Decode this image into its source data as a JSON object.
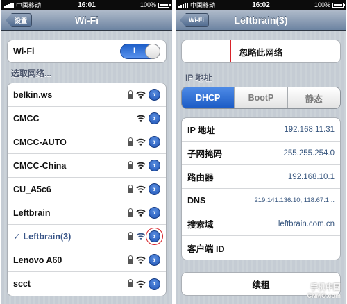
{
  "left": {
    "status": {
      "carrier": "中国移动",
      "time": "16:01",
      "battery": "100%"
    },
    "nav": {
      "back_label": "设置",
      "title": "Wi-Fi"
    },
    "wifi_toggle": {
      "label": "Wi-Fi",
      "state_label": "I"
    },
    "section_label": "选取网络...",
    "networks": [
      {
        "name": "belkin.ws",
        "locked": true
      },
      {
        "name": "CMCC",
        "locked": false
      },
      {
        "name": "CMCC-AUTO",
        "locked": true
      },
      {
        "name": "CMCC-China",
        "locked": true
      },
      {
        "name": "CU_A5c6",
        "locked": true
      },
      {
        "name": "Leftbrain",
        "locked": true
      },
      {
        "name": "Leftbrain(3)",
        "locked": true,
        "selected": true,
        "check": "✓"
      },
      {
        "name": "Lenovo A60",
        "locked": true
      },
      {
        "name": "scct",
        "locked": true
      }
    ]
  },
  "right": {
    "status": {
      "carrier": "中国移动",
      "time": "16:02",
      "battery": "100%"
    },
    "nav": {
      "back_label": "Wi-Fi",
      "title": "Leftbrain(3)"
    },
    "forget_label": "忽略此网络",
    "ip_section_label": "IP 地址",
    "segments": [
      "DHCP",
      "BootP",
      "静态"
    ],
    "fields": [
      {
        "label": "IP 地址",
        "value": "192.168.11.31"
      },
      {
        "label": "子网掩码",
        "value": "255.255.254.0"
      },
      {
        "label": "路由器",
        "value": "192.168.10.1"
      },
      {
        "label": "DNS",
        "value": "219.141.136.10, 118.67.1..."
      },
      {
        "label": "搜索域",
        "value": "leftbrain.com.cn"
      },
      {
        "label": "客户端 ID",
        "value": ""
      }
    ],
    "renew_label": "续租",
    "watermark": {
      "line1": "手机中国",
      "line2": "CNMO.com"
    }
  },
  "colors": {
    "accent": "#1d52b5",
    "highlight": "#d8232a",
    "value_text": "#36557e"
  }
}
